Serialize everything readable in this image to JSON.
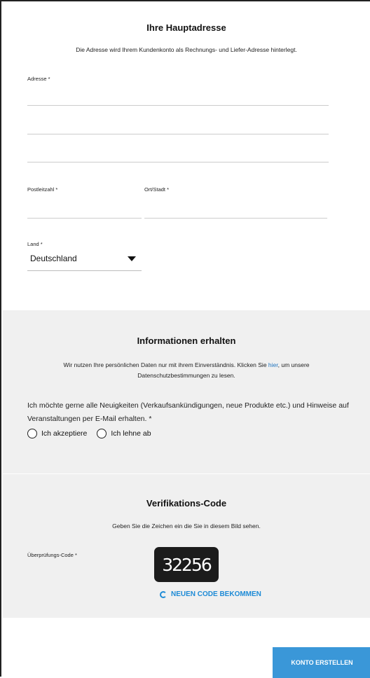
{
  "address": {
    "title": "Ihre Hauptadresse",
    "subtitle": "Die Adresse wird Ihrem Kundenkonto als Rechnungs- und Liefer-Adresse hinterlegt.",
    "address_label": "Adresse *",
    "zip_label": "Postleitzahl *",
    "city_label": "Ort/Stadt *",
    "country_label": "Land *",
    "country_value": "Deutschland"
  },
  "info": {
    "title": "Informationen erhalten",
    "text_before_link": "Wir nutzen Ihre persönlichen Daten nur mit ihrem Einverständnis. Klicken Sie ",
    "link": "hier",
    "text_after_link": ", um unsere Datenschutzbestimmungen zu lesen.",
    "question": "Ich möchte gerne alle Neuigkeiten (Verkaufsankündigungen, neue Produkte etc.) und Hinweise auf Veranstaltungen per E-Mail erhalten. *",
    "accept": "Ich akzeptiere",
    "decline": "Ich lehne ab"
  },
  "verify": {
    "title": "Verifikations-Code",
    "subtitle": "Geben Sie die Zeichen ein die Sie in diesem Bild sehen.",
    "code_label": "Überprüfungs-Code *",
    "captcha": "32256",
    "refresh": "NEUEN CODE BEKOMMEN"
  },
  "footer": {
    "submit": "KONTO ERSTELLEN"
  }
}
